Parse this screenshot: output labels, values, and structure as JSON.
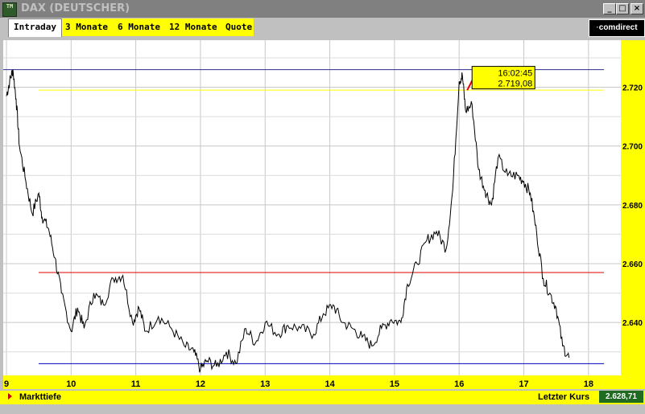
{
  "window": {
    "title": "DAX (DEUTSCHER)",
    "icon_text": "TM",
    "controls": [
      "_",
      "□",
      "×"
    ]
  },
  "tabs": [
    {
      "label": "Intraday",
      "active": true
    },
    {
      "label": "3 Monate",
      "active": false
    },
    {
      "label": "6 Monate",
      "active": false
    },
    {
      "label": "12 Monate",
      "active": false
    },
    {
      "label": "Quote",
      "active": false
    }
  ],
  "brand": "comdirect",
  "chart_data": {
    "type": "line",
    "x_ticks": [
      "9",
      "10",
      "11",
      "12",
      "13",
      "14",
      "15",
      "16",
      "17",
      "18"
    ],
    "y_ticks": [
      "2.640",
      "2.660",
      "2.680",
      "2.700",
      "2.720"
    ],
    "xlim": [
      9,
      18.5
    ],
    "ylim": [
      2622,
      2736
    ],
    "series": [
      {
        "values": [
          [
            9.0,
            2717
          ],
          [
            9.05,
            2722
          ],
          [
            9.1,
            2726
          ],
          [
            9.15,
            2716
          ],
          [
            9.2,
            2700
          ],
          [
            9.3,
            2688
          ],
          [
            9.4,
            2677
          ],
          [
            9.5,
            2684
          ],
          [
            9.55,
            2676
          ],
          [
            9.65,
            2672
          ],
          [
            9.75,
            2662
          ],
          [
            9.85,
            2650
          ],
          [
            10.0,
            2637
          ],
          [
            10.1,
            2645
          ],
          [
            10.2,
            2638
          ],
          [
            10.35,
            2650
          ],
          [
            10.5,
            2646
          ],
          [
            10.65,
            2655
          ],
          [
            10.8,
            2656
          ],
          [
            10.95,
            2640
          ],
          [
            11.05,
            2645
          ],
          [
            11.15,
            2637
          ],
          [
            11.35,
            2642
          ],
          [
            11.55,
            2638
          ],
          [
            11.75,
            2632
          ],
          [
            11.9,
            2630
          ],
          [
            12.0,
            2624
          ],
          [
            12.1,
            2627
          ],
          [
            12.25,
            2625
          ],
          [
            12.4,
            2630
          ],
          [
            12.55,
            2626
          ],
          [
            12.7,
            2638
          ],
          [
            12.85,
            2633
          ],
          [
            13.0,
            2640
          ],
          [
            13.2,
            2636
          ],
          [
            13.35,
            2639
          ],
          [
            13.55,
            2638
          ],
          [
            13.75,
            2636
          ],
          [
            13.9,
            2643
          ],
          [
            14.05,
            2646
          ],
          [
            14.2,
            2640
          ],
          [
            14.35,
            2638
          ],
          [
            14.5,
            2635
          ],
          [
            14.65,
            2632
          ],
          [
            14.8,
            2638
          ],
          [
            14.95,
            2641
          ],
          [
            15.1,
            2640
          ],
          [
            15.2,
            2653
          ],
          [
            15.35,
            2660
          ],
          [
            15.5,
            2668
          ],
          [
            15.65,
            2671
          ],
          [
            15.8,
            2665
          ],
          [
            15.9,
            2685
          ],
          [
            16.0,
            2722
          ],
          [
            16.05,
            2724
          ],
          [
            16.1,
            2712
          ],
          [
            16.2,
            2714
          ],
          [
            16.3,
            2692
          ],
          [
            16.4,
            2685
          ],
          [
            16.5,
            2680
          ],
          [
            16.6,
            2696
          ],
          [
            16.75,
            2690
          ],
          [
            16.9,
            2690
          ],
          [
            17.0,
            2688
          ],
          [
            17.1,
            2684
          ],
          [
            17.2,
            2670
          ],
          [
            17.3,
            2655
          ],
          [
            17.4,
            2650
          ],
          [
            17.5,
            2645
          ],
          [
            17.6,
            2632
          ],
          [
            17.7,
            2628
          ]
        ]
      }
    ],
    "hlines": [
      {
        "y": 2726,
        "color": "#2b2b8c"
      },
      {
        "y": 2719,
        "color": "#ffff00"
      },
      {
        "y": 2657,
        "color": "#e00000"
      },
      {
        "y": 2626,
        "color": "#0000c0"
      }
    ],
    "tooltip": {
      "time": "16:02:45",
      "value": "2.719,08"
    },
    "grid": true
  },
  "bottom": {
    "markttiefe": "Markttiefe",
    "letzter_kurs_label": "Letzter Kurs",
    "letzter_kurs_value": "2.628,71"
  }
}
